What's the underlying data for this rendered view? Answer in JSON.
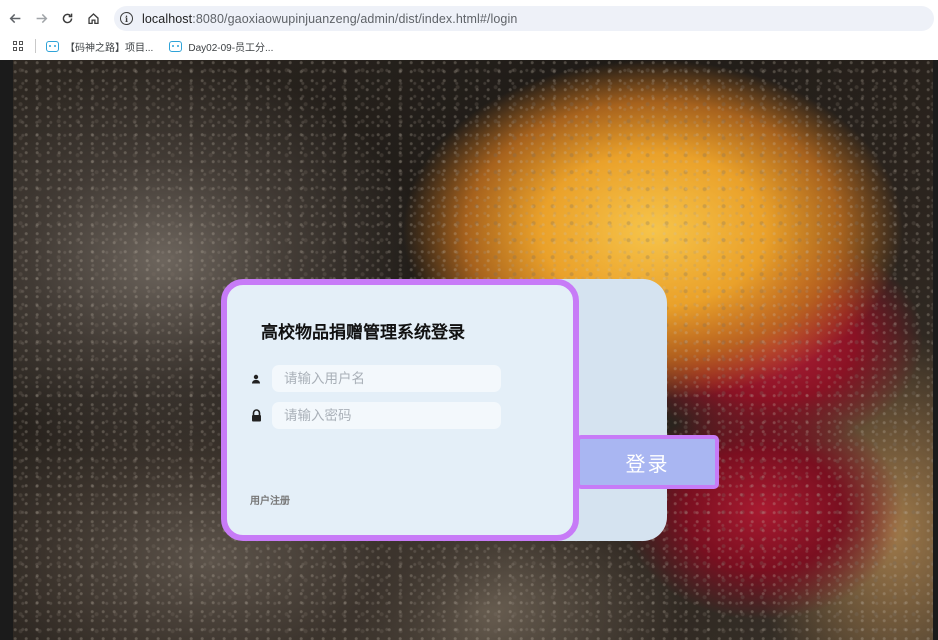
{
  "browser": {
    "url_host": "localhost",
    "url_rest": ":8080/gaoxiaowupinjuanzeng/admin/dist/index.html#/login",
    "bookmarks": [
      {
        "label": "【码神之路】项目..."
      },
      {
        "label": "Day02-09-员工分..."
      }
    ]
  },
  "login": {
    "title": "高校物品捐赠管理系统登录",
    "username_placeholder": "请输入用户名",
    "password_placeholder": "请输入密码",
    "register_label": "用户注册",
    "login_button": "登录"
  },
  "colors": {
    "accent_border": "#c77bf7",
    "button_bg": "#a9b6f2",
    "card_bg": "#e4eff8"
  },
  "icons": [
    "back-arrow-icon",
    "forward-arrow-icon",
    "reload-icon",
    "home-icon",
    "info-icon",
    "apps-grid-icon",
    "bilibili-icon",
    "user-icon",
    "lock-icon"
  ]
}
